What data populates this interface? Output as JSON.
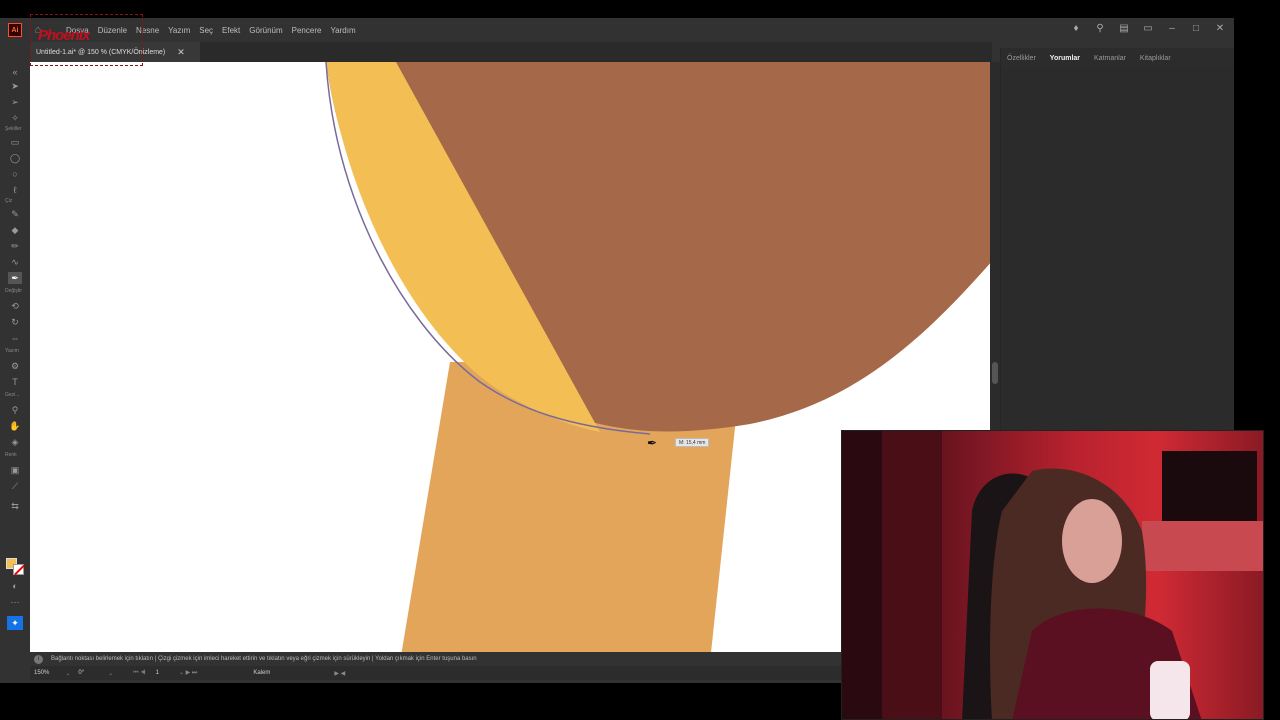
{
  "app": {
    "logo_text": "Ai",
    "menu": [
      "Dosya",
      "Düzenle",
      "Nesne",
      "Yazım",
      "Seç",
      "Efekt",
      "Görünüm",
      "Pencere",
      "Yardım"
    ]
  },
  "document_tab": {
    "title": "Untitled-1.ai* @ 150 % (CMYK/Önizleme)"
  },
  "toolbar_labels": {
    "shapes": "Şekiller",
    "draw": "Çiz",
    "modify": "Değiştir",
    "type": "Yazım",
    "nav": "Gezi...",
    "color": "Renk"
  },
  "panel": {
    "tabs": [
      "Özellikler",
      "Yorumlar",
      "Katmanlar",
      "Kitaplıklar"
    ],
    "active_tab": "Yorumlar"
  },
  "canvas": {
    "measure_tooltip": "M: 15,4 mm",
    "colors": {
      "face_brown": "#a56848",
      "hair_yellow": "#f3bf55",
      "neck_orange": "#e3a55a",
      "path_stroke": "#7a6a9a"
    }
  },
  "hint_bar": {
    "text": "Bağlantı noktası belirlemek için tıklatın  |  Çizgi çizmek için imleci hareket ettirin ve tıklatın veya eğri çizmek için sürükleyin  |  Yoldan çıkmak için Enter tuşuna basın"
  },
  "status_bar": {
    "zoom": "150%",
    "rotation": "0°",
    "artboard": "1",
    "tool": "Kalem"
  },
  "watermark": {
    "text": "Phoenix"
  }
}
